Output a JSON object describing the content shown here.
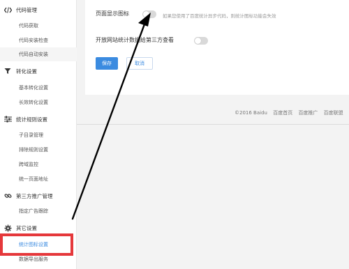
{
  "sidebar": {
    "groups": [
      {
        "title": "代码管理",
        "icon": "code-icon",
        "items": [
          {
            "label": "代码获取"
          },
          {
            "label": "代码安装检查"
          },
          {
            "label": "代码自动安装"
          }
        ]
      },
      {
        "title": "转化设置",
        "icon": "funnel-icon",
        "items": [
          {
            "label": "基本转化设置"
          },
          {
            "label": "长效转化设置"
          }
        ]
      },
      {
        "title": "统计规则设置",
        "icon": "sliders-icon",
        "items": [
          {
            "label": "子目录管理"
          },
          {
            "label": "排除规则设置"
          },
          {
            "label": "跨域监控"
          },
          {
            "label": "统一页面地址"
          }
        ]
      },
      {
        "title": "第三方推广管理",
        "icon": "link-icon",
        "items": [
          {
            "label": "指定广告跟踪"
          }
        ]
      },
      {
        "title": "其它设置",
        "icon": "gear-icon",
        "items": [
          {
            "label": "统计图标设置"
          },
          {
            "label": "数据导出服务"
          }
        ]
      }
    ]
  },
  "main": {
    "show_icon_label": "页面显示图标",
    "show_icon_hint": "如果您使用了百度统计异步代码，则统计图标功能会失效",
    "open_stats_label": "开放网站统计数据给第三方查看",
    "save_label": "保存",
    "cancel_label": "取消",
    "show_icon_enabled": false,
    "open_stats_enabled": false
  },
  "footer": {
    "copyright": "©2016 Baidu",
    "links": [
      "百度首页",
      "百度推广",
      "百度联盟"
    ]
  },
  "colors": {
    "accent": "#3b8be0",
    "highlight_box": "#e5383b"
  }
}
